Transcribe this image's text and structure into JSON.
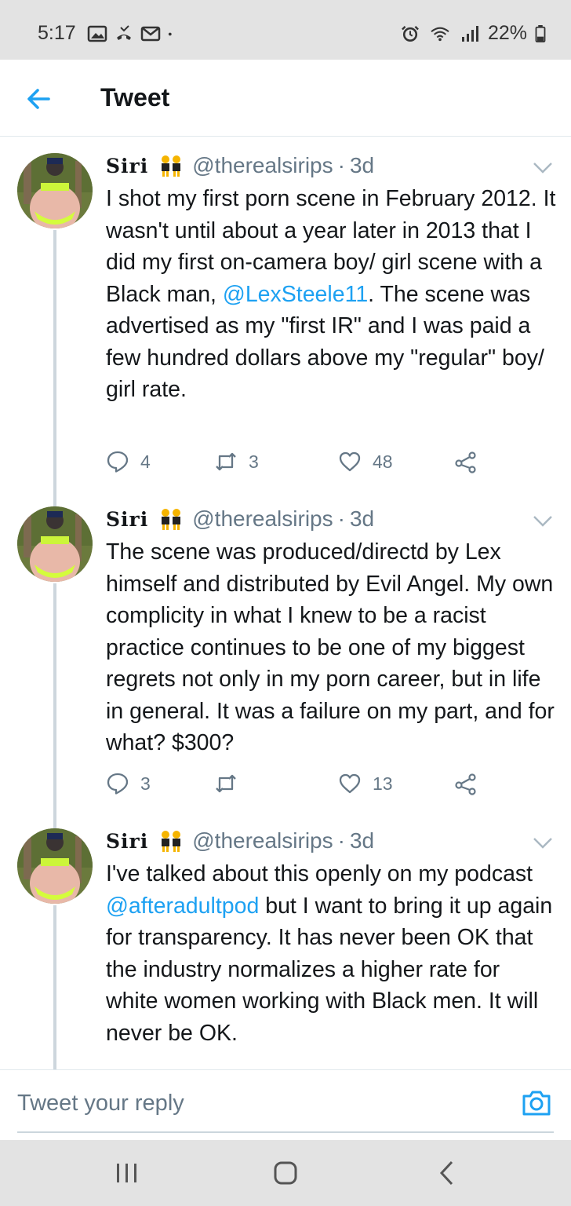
{
  "status_bar": {
    "time": "5:17",
    "battery": "22%",
    "left_icons": [
      "image-icon",
      "missed-call-icon",
      "mail-icon",
      "dot-icon"
    ],
    "right_icons": [
      "alarm-icon",
      "wifi-icon",
      "signal-icon",
      "battery-icon"
    ]
  },
  "header": {
    "title": "Tweet",
    "back_icon": "arrow-left-icon"
  },
  "tweets": [
    {
      "name": "Siri",
      "handle": "@therealsirips",
      "separator": "·",
      "time": "3d",
      "text_parts": [
        "I shot my first porn scene in February 2012. It wasn't until about a year later in 2013 that I did my first on-camera boy/ girl scene with a Black man, ",
        "@LexSteele11",
        ". The scene was advertised as my \"first IR\" and I was paid a few hundred dollars above my \"regular\" boy/ girl rate."
      ],
      "replies": "4",
      "retweets": "3",
      "likes": "48"
    },
    {
      "name": "Siri",
      "handle": "@therealsirips",
      "separator": "·",
      "time": "3d",
      "text": "The scene was produced/directd by Lex himself and distributed by Evil Angel. My own complicity in what I knew to be a racist practice continues to be one of my biggest regrets not only in my porn career, but in life in general. It was a failure on my part, and for what? $300?",
      "replies": "3",
      "retweets": "",
      "likes": "13"
    },
    {
      "name": "Siri",
      "handle": "@therealsirips",
      "separator": "·",
      "time": "3d",
      "text_parts": [
        "I've talked about this openly on my podcast ",
        "@afteradultpod",
        " but I want to bring it up again for transparency. It has never been OK that the industry normalizes a higher rate for white women working with Black men. It will never be OK."
      ]
    }
  ],
  "reply_bar": {
    "placeholder": "Tweet your reply",
    "icon": "camera-icon"
  },
  "nav_bar": {
    "icons": [
      "recent-apps-icon",
      "home-icon",
      "back-icon"
    ]
  },
  "colors": {
    "accent": "#1da1f2",
    "secondary_text": "#657786",
    "thread_line": "#cdd6dd"
  }
}
